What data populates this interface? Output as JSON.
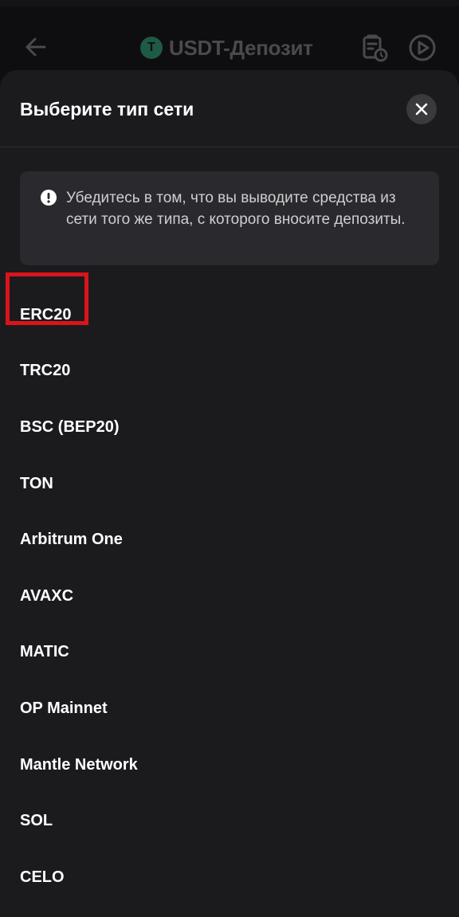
{
  "header": {
    "title": "USDT-Депозит",
    "coin_symbol": "T",
    "icons": [
      "back-arrow-icon",
      "tether-coin-icon",
      "history-icon",
      "play-circle-icon"
    ]
  },
  "sheet": {
    "title": "Выберите тип сети",
    "close_icon": "close-icon",
    "warning": {
      "icon": "exclamation-icon",
      "text": "Убедитесь в том, что вы выводите средства из сети того же типа, с которого вносите депозиты."
    },
    "networks": [
      {
        "label": "ERC20"
      },
      {
        "label": "TRC20",
        "highlighted": true
      },
      {
        "label": "BSC (BEP20)"
      },
      {
        "label": "TON"
      },
      {
        "label": "Arbitrum One"
      },
      {
        "label": "AVAXC"
      },
      {
        "label": "MATIC"
      },
      {
        "label": "OP Mainnet"
      },
      {
        "label": "Mantle Network"
      },
      {
        "label": "SOL"
      },
      {
        "label": "CELO"
      }
    ]
  },
  "colors": {
    "background": "#0c0c0e",
    "sheet": "#1b1b1e",
    "warning_bg": "#2a2a2e",
    "highlight": "#d9141b",
    "coin": "#1f5a46"
  }
}
